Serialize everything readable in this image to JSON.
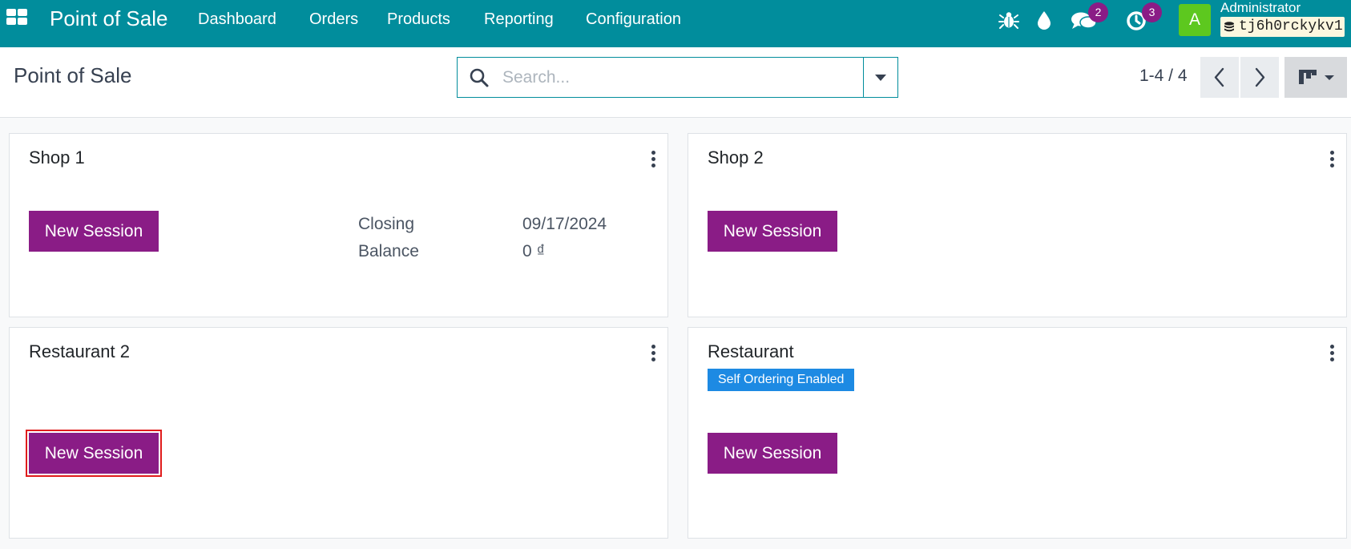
{
  "navbar": {
    "brand": "Point of Sale",
    "menus": [
      "Dashboard",
      "Orders",
      "Products",
      "Reporting",
      "Configuration"
    ],
    "messages_badge": "2",
    "activities_badge": "3",
    "avatar_letter": "A",
    "user_name": "Administrator",
    "database": "tj6h0rckykv1",
    "icons": [
      "apps-grid-icon",
      "bug-icon",
      "drop-icon",
      "chat-icon",
      "clock-icon",
      "database-icon"
    ]
  },
  "control_panel": {
    "title": "Point of Sale",
    "search_placeholder": "Search...",
    "pager": "1-4 / 4"
  },
  "cards": [
    {
      "title": "Shop 1",
      "button": "New Session",
      "stats": [
        {
          "label": "Closing",
          "value": "09/17/2024"
        },
        {
          "label": "Balance",
          "value": "0 ₫"
        }
      ]
    },
    {
      "title": "Shop 2",
      "button": "New Session"
    },
    {
      "title": "Restaurant 2",
      "button": "New Session",
      "highlighted": true
    },
    {
      "title": "Restaurant",
      "badge": "Self Ordering Enabled",
      "button": "New Session"
    }
  ],
  "colors": {
    "navbar": "#018d9c",
    "primary_button": "#8a1c86",
    "badge_blue": "#1d8ae3",
    "highlight_outline": "#e01c1c",
    "avatar": "#5dc81f"
  }
}
